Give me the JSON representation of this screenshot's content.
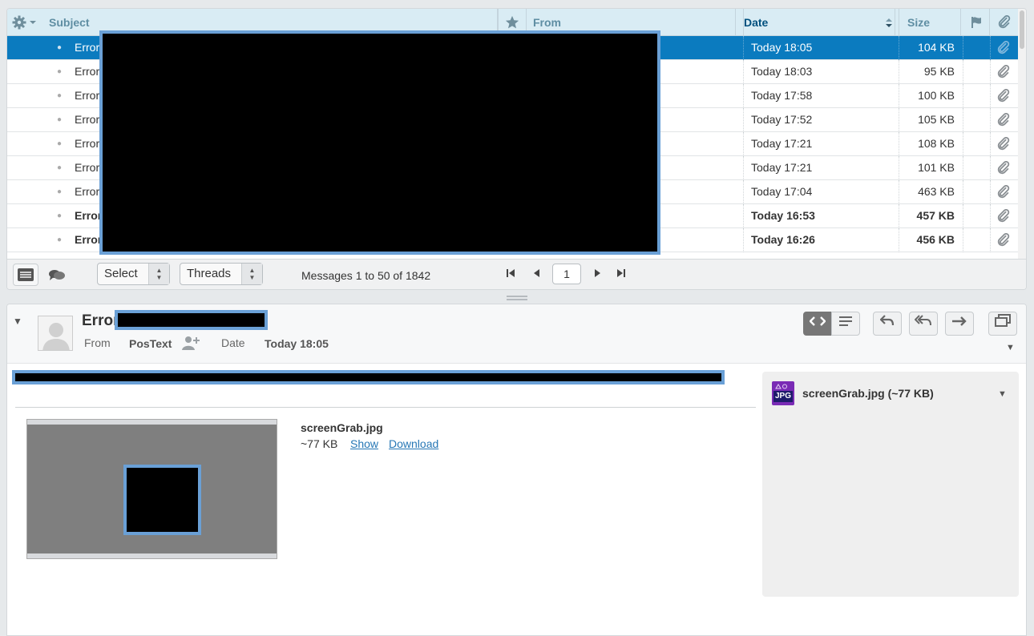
{
  "list": {
    "columns": {
      "subject": "Subject",
      "from": "From",
      "date": "Date",
      "size": "Size"
    },
    "rows": [
      {
        "subject": "Error",
        "date": "Today 18:05",
        "size": "104 KB",
        "selected": true,
        "unread": false
      },
      {
        "subject": "Error",
        "date": "Today 18:03",
        "size": "95 KB",
        "selected": false,
        "unread": false
      },
      {
        "subject": "Error",
        "date": "Today 17:58",
        "size": "100 KB",
        "selected": false,
        "unread": false
      },
      {
        "subject": "Error",
        "date": "Today 17:52",
        "size": "105 KB",
        "selected": false,
        "unread": false
      },
      {
        "subject": "Error",
        "date": "Today 17:21",
        "size": "108 KB",
        "selected": false,
        "unread": false
      },
      {
        "subject": "Error",
        "date": "Today 17:21",
        "size": "101 KB",
        "selected": false,
        "unread": false
      },
      {
        "subject": "Error",
        "date": "Today 17:04",
        "size": "463 KB",
        "selected": false,
        "unread": false
      },
      {
        "subject": "Error",
        "date": "Today 16:53",
        "size": "457 KB",
        "selected": false,
        "unread": true
      },
      {
        "subject": "Error",
        "date": "Today 16:26",
        "size": "456 KB",
        "selected": false,
        "unread": true
      }
    ]
  },
  "footer": {
    "select_label": "Select",
    "threads_label": "Threads",
    "message_count": "Messages 1 to 50 of 1842",
    "page": "1"
  },
  "preview": {
    "subject": "Error",
    "from_label": "From",
    "from_value": "PosText",
    "date_label": "Date",
    "date_value": "Today 18:05",
    "attachment": {
      "name": "screenGrab.jpg",
      "size": "~77 KB",
      "show_label": "Show",
      "download_label": "Download",
      "side_label": "screenGrab.jpg (~77 KB)",
      "icon_text": "JPG"
    }
  },
  "colors": {
    "selected_row": "#0b7bbf",
    "header_bg": "#d9ecf4",
    "link": "#2677b5",
    "redaction_border": "#6aa0d6"
  }
}
